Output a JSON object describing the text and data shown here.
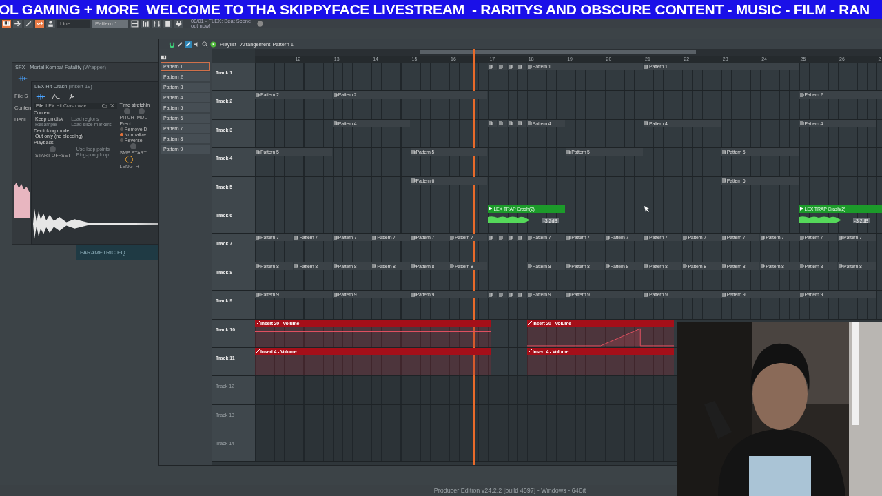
{
  "banner": {
    "text": "OL GAMING + MORE  WELCOME TO THA SKIPPYFACE LIVESTREAM  - RARITYS AND OBSCURE CONTENT - MUSIC - FILM - RAN"
  },
  "toolbar": {
    "snap": "Line",
    "pattern": "Pattern 1",
    "hint": [
      "00/01 - FLEX: Beat Scene",
      "out now!"
    ]
  },
  "channel_window": {
    "title": "SFX - Mortal Kombat Fatality",
    "title_note": "(Wrapper)",
    "side_labels": [
      "File S",
      "Conten",
      "Decli"
    ]
  },
  "sampler": {
    "title": "LEX Hit Crash",
    "title_note": "(Insert 19)",
    "file_label": "File",
    "file_name": "LEX Hit Crash.wav",
    "content_heading": "Content",
    "content_options": [
      {
        "label": "Keep on disk",
        "disabled": false
      },
      {
        "label": "Load regions",
        "disabled": true
      },
      {
        "label": "Resample",
        "disabled": true
      },
      {
        "label": "Load slice markers",
        "disabled": true
      }
    ],
    "declick_label": "Declicking mode",
    "declick_value": "Out only (no bleeding)",
    "playback_heading": "Playback",
    "playback_options": [
      {
        "label": "Use loop points",
        "disabled": true
      },
      {
        "label": "Ping-pong loop",
        "disabled": true
      }
    ],
    "knob_label": "START OFFSET",
    "time_heading": "Time stretchin",
    "time_knobs": [
      "PITCH",
      "MUL"
    ],
    "precision": "Preci",
    "toggles": [
      {
        "label": "Remove D",
        "on": false
      },
      {
        "label": "Normalize",
        "on": true
      },
      {
        "label": "Reverse",
        "on": false
      }
    ],
    "env_knobs": [
      "SMP START",
      "LENGTH"
    ]
  },
  "eq_panel": {
    "title": "PARAMETRIC EQ"
  },
  "playlist": {
    "title": "Playlist - Arrangement",
    "breadcrumb": "Pattern 1",
    "patterns": [
      {
        "label": "Pattern 1",
        "selected": true
      },
      {
        "label": "Pattern 2",
        "selected": false
      },
      {
        "label": "Pattern 3",
        "selected": false
      },
      {
        "label": "Pattern 4",
        "selected": false
      },
      {
        "label": "Pattern 5",
        "selected": false
      },
      {
        "label": "Pattern 6",
        "selected": false
      },
      {
        "label": "Pattern 7",
        "selected": false
      },
      {
        "label": "Pattern 8",
        "selected": false
      },
      {
        "label": "Pattern 9",
        "selected": false
      }
    ],
    "ruler": [
      "12",
      "13",
      "14",
      "15",
      "16",
      "17",
      "18",
      "19",
      "20",
      "21",
      "22",
      "23",
      "24",
      "25",
      "26",
      "2"
    ],
    "tracks": [
      {
        "name": "Track 1",
        "disabled": false,
        "clips": [
          {
            "kind": "stub"
          },
          {
            "kind": "stub"
          },
          {
            "kind": "stub"
          },
          {
            "kind": "stub"
          },
          {
            "kind": "pattern",
            "label": "Pattern 1"
          },
          {
            "kind": "pattern",
            "label": "Pattern 1"
          }
        ]
      },
      {
        "name": "Track 2",
        "disabled": false,
        "clips": [
          {
            "kind": "pattern",
            "label": "Pattern 2"
          },
          {
            "kind": "pattern",
            "label": "Pattern 2"
          },
          {
            "kind": "pattern",
            "label": "Pattern 2"
          }
        ]
      },
      {
        "name": "Track 3",
        "disabled": false,
        "clips": [
          {
            "kind": "pattern",
            "label": "Pattern 4"
          },
          {
            "kind": "stub"
          },
          {
            "kind": "stub"
          },
          {
            "kind": "stub"
          },
          {
            "kind": "stub"
          },
          {
            "kind": "pattern",
            "label": "Pattern 4"
          },
          {
            "kind": "pattern",
            "label": "Pattern 4"
          },
          {
            "kind": "pattern",
            "label": "Pattern 4"
          }
        ]
      },
      {
        "name": "Track 4",
        "disabled": false,
        "clips": [
          {
            "kind": "pattern",
            "label": "Pattern 5"
          },
          {
            "kind": "pattern",
            "label": "Pattern 5"
          },
          {
            "kind": "pattern",
            "label": "Pattern 5"
          },
          {
            "kind": "pattern",
            "label": "Pattern 5"
          }
        ]
      },
      {
        "name": "Track 5",
        "disabled": false,
        "clips": [
          {
            "kind": "pattern",
            "label": "Pattern 6"
          },
          {
            "kind": "pattern",
            "label": "Pattern 6"
          }
        ]
      },
      {
        "name": "Track 6",
        "disabled": false,
        "clips": [
          {
            "kind": "audio",
            "label": "LEX TRAP Crash(2)",
            "reading": "-3.2dB"
          },
          {
            "kind": "audio",
            "label": "LEX TRAP Crash(2)",
            "reading": "-3.2dB"
          }
        ]
      },
      {
        "name": "Track 7",
        "disabled": false,
        "clips": [
          {
            "kind": "pattern",
            "label": "Pattern 7"
          },
          {
            "kind": "pattern",
            "label": "Pattern 7"
          },
          {
            "kind": "pattern",
            "label": "Pattern 7"
          },
          {
            "kind": "pattern",
            "label": "Pattern 7"
          },
          {
            "kind": "pattern",
            "label": "Pattern 7"
          },
          {
            "kind": "pattern",
            "label": "Pattern 7"
          },
          {
            "kind": "stub"
          },
          {
            "kind": "stub"
          },
          {
            "kind": "stub"
          },
          {
            "kind": "stub"
          },
          {
            "kind": "pattern",
            "label": "Pattern 7"
          },
          {
            "kind": "pattern",
            "label": "Pattern 7"
          },
          {
            "kind": "pattern",
            "label": "Pattern 7"
          },
          {
            "kind": "pattern",
            "label": "Pattern 7"
          },
          {
            "kind": "pattern",
            "label": "Pattern 7"
          },
          {
            "kind": "pattern",
            "label": "Pattern 7"
          },
          {
            "kind": "pattern",
            "label": "Pattern 7"
          },
          {
            "kind": "pattern",
            "label": "Pattern 7"
          },
          {
            "kind": "pattern",
            "label": "Pattern 7"
          }
        ]
      },
      {
        "name": "Track 8",
        "disabled": false,
        "clips": [
          {
            "kind": "pattern",
            "label": "Pattern 8"
          },
          {
            "kind": "pattern",
            "label": "Pattern 8"
          },
          {
            "kind": "pattern",
            "label": "Pattern 8"
          },
          {
            "kind": "pattern",
            "label": "Pattern 8"
          },
          {
            "kind": "pattern",
            "label": "Pattern 8"
          },
          {
            "kind": "pattern",
            "label": "Pattern 8"
          },
          {
            "kind": "pattern",
            "label": "Pattern 8"
          },
          {
            "kind": "pattern",
            "label": "Pattern 8"
          },
          {
            "kind": "pattern",
            "label": "Pattern 8"
          },
          {
            "kind": "pattern",
            "label": "Pattern 8"
          },
          {
            "kind": "pattern",
            "label": "Pattern 8"
          },
          {
            "kind": "pattern",
            "label": "Pattern 8"
          },
          {
            "kind": "pattern",
            "label": "Pattern 8"
          },
          {
            "kind": "pattern",
            "label": "Pattern 8"
          },
          {
            "kind": "pattern",
            "label": "Pattern 8"
          }
        ]
      },
      {
        "name": "Track 9",
        "disabled": false,
        "clips": [
          {
            "kind": "pattern",
            "label": "Pattern 9"
          },
          {
            "kind": "pattern",
            "label": "Pattern 9"
          },
          {
            "kind": "pattern",
            "label": "Pattern 9"
          },
          {
            "kind": "stub"
          },
          {
            "kind": "stub"
          },
          {
            "kind": "stub"
          },
          {
            "kind": "stub"
          },
          {
            "kind": "pattern",
            "label": "Pattern 9"
          },
          {
            "kind": "pattern",
            "label": "Pattern 9"
          },
          {
            "kind": "pattern",
            "label": "Pattern 9"
          },
          {
            "kind": "pattern",
            "label": "Pattern 9"
          },
          {
            "kind": "pattern",
            "label": "Pattern 9"
          }
        ]
      },
      {
        "name": "Track 10",
        "disabled": false,
        "clips": [
          {
            "kind": "automation",
            "label": "Insert 20 - Volume"
          },
          {
            "kind": "automation",
            "label": "Insert 20 - Volume"
          }
        ]
      },
      {
        "name": "Track 11",
        "disabled": false,
        "clips": [
          {
            "kind": "automation",
            "label": "Insert 4 - Volume"
          },
          {
            "kind": "automation",
            "label": "Insert 4 - Volume"
          }
        ]
      },
      {
        "name": "Track 12",
        "disabled": true
      },
      {
        "name": "Track 13",
        "disabled": true
      },
      {
        "name": "Track 14",
        "disabled": true
      }
    ]
  },
  "status_bar": {
    "text": "Producer Edition v24.2.2 [build 4597] - Windows - 64Bit"
  }
}
